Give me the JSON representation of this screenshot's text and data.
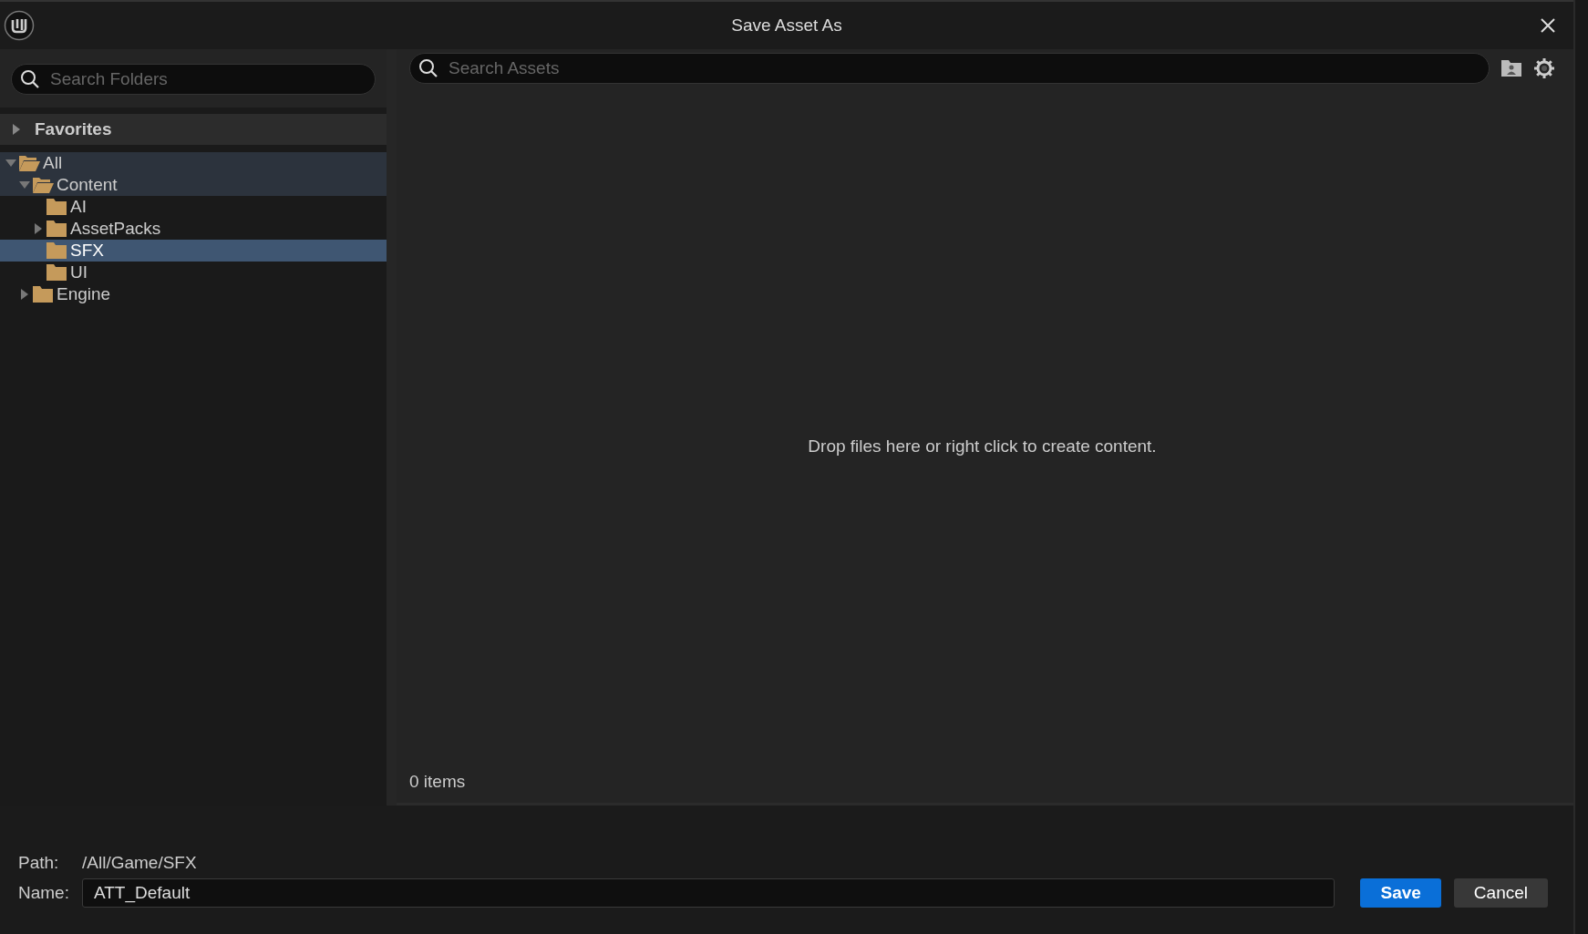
{
  "window": {
    "title": "Save Asset As"
  },
  "folders_search": {
    "placeholder": "Search Folders"
  },
  "favorites": {
    "label": "Favorites",
    "expanded": false
  },
  "tree": [
    {
      "label": "All",
      "expandable": true,
      "expanded": true,
      "selected": false,
      "children": [
        {
          "label": "Content",
          "expandable": true,
          "expanded": true,
          "selected": false,
          "children": [
            {
              "label": "AI",
              "expandable": false,
              "expanded": false,
              "selected": false
            },
            {
              "label": "AssetPacks",
              "expandable": true,
              "expanded": false,
              "selected": false
            },
            {
              "label": "SFX",
              "expandable": false,
              "expanded": false,
              "selected": true
            },
            {
              "label": "UI",
              "expandable": false,
              "expanded": false,
              "selected": false
            }
          ]
        },
        {
          "label": "Engine",
          "expandable": true,
          "expanded": false,
          "selected": false
        }
      ]
    }
  ],
  "assets_search": {
    "placeholder": "Search Assets"
  },
  "empty_message": "Drop files here or right click to create content.",
  "item_count": "0 items",
  "path": {
    "label": "Path:",
    "value": "/All/Game/SFX"
  },
  "name": {
    "label": "Name:",
    "value": "ATT_Default"
  },
  "buttons": [
    {
      "label": "Save",
      "kind": "primary"
    },
    {
      "label": "Cancel",
      "kind": "secondary"
    }
  ]
}
